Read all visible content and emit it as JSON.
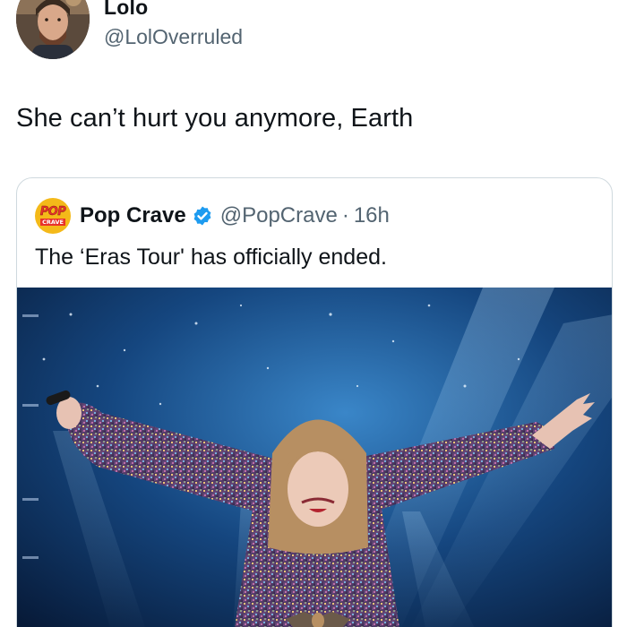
{
  "post": {
    "author": {
      "display_name": "Lolo",
      "handle": "@LolOverruled",
      "avatar": "user-avatar"
    },
    "text": "She can’t hurt you anymore, Earth",
    "quoted_post": {
      "author": {
        "display_name": "Pop Crave",
        "handle": "@PopCrave",
        "verified": true,
        "logo": {
          "line1": "POP",
          "line2": "CRAVE"
        }
      },
      "separator": "·",
      "time": "16h",
      "text": "The ‘Eras Tour' has officially ended.",
      "media": {
        "type": "concert-photo",
        "description_icon": "concert-performer-image"
      }
    }
  },
  "colors": {
    "text_primary": "#0f1419",
    "text_secondary": "#536471",
    "verified_blue": "#1d9bf0",
    "card_border": "#cfd9de",
    "logo_yellow": "#f4b919",
    "logo_red": "#e8322a"
  }
}
